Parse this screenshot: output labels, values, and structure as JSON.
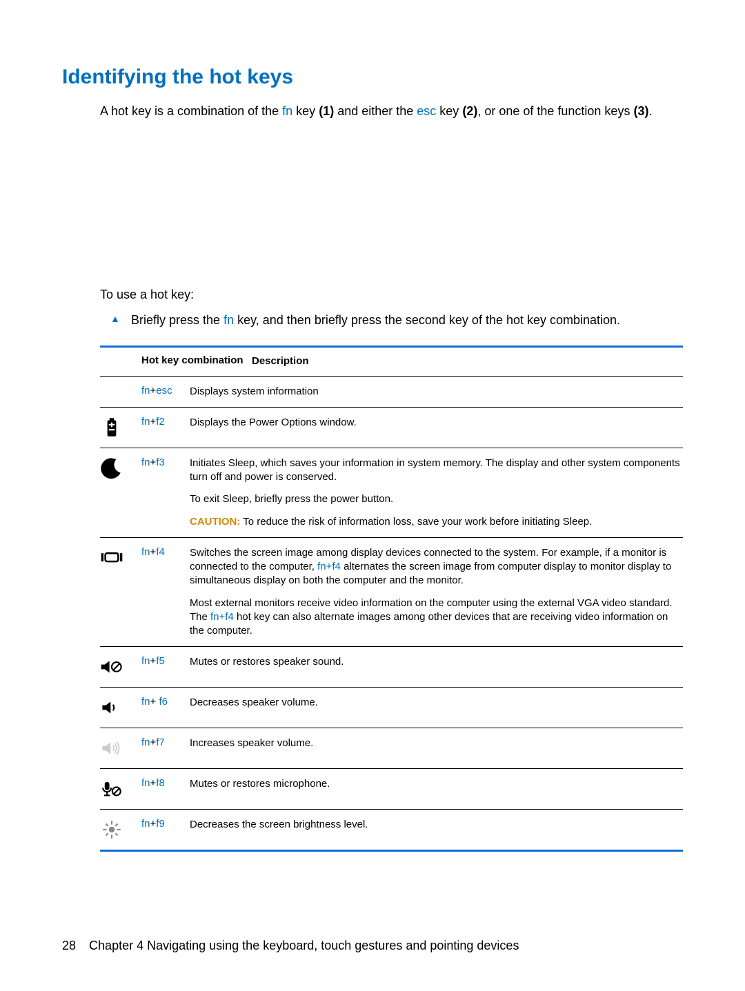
{
  "title": "Identifying the hot keys",
  "intro": {
    "pre": "A hot key is a combination of the ",
    "fn": "fn",
    "mid1": " key ",
    "one": "(1)",
    "mid2": " and either the ",
    "esc": "esc",
    "mid3": " key ",
    "two": "(2)",
    "mid4": ", or one of the function keys ",
    "three": "(3)",
    "end": "."
  },
  "use_line": "To use a hot key:",
  "bullet": {
    "pre": "Briefly press the ",
    "fn": "fn",
    "post": " key, and then briefly press the second key of the hot key combination."
  },
  "hdr": {
    "combo": "Hot key combination",
    "desc": "Description"
  },
  "rows": [
    {
      "icon": "",
      "k1": "fn",
      "op": "+",
      "k2": "esc",
      "desc": "Displays system information"
    },
    {
      "icon": "battery",
      "k1": "fn",
      "op": "+",
      "k2": "f2",
      "desc": "Displays the Power Options window."
    },
    {
      "icon": "moon",
      "k1": "fn",
      "op": "+",
      "k2": "f3",
      "p1": "Initiates Sleep, which saves your information in system memory. The display and other system components turn off and power is conserved.",
      "p2": "To exit Sleep, briefly press the power button.",
      "caution_label": "CAUTION:",
      "caution_text": "  To reduce the risk of information loss, save your work before initiating Sleep."
    },
    {
      "icon": "display",
      "k1": "fn",
      "op": "+",
      "k2": "f4",
      "p1a": "Switches the screen image among display devices connected to the system. For example, if a monitor is connected to the computer, ",
      "p1k": "fn+f4",
      "p1b": " alternates the screen image from computer display to monitor display to simultaneous display on both the computer and the monitor.",
      "p2a": "Most external monitors receive video information on the computer using the external VGA video standard. The ",
      "p2k": "fn+f4",
      "p2b": " hot key can also alternate images among other devices that are receiving video information on the computer."
    },
    {
      "icon": "mute",
      "k1": "fn",
      "op": "+",
      "k2": "f5",
      "desc": "Mutes or restores speaker sound."
    },
    {
      "icon": "voldown",
      "k1": "fn",
      "op": "+ ",
      "k2": "f6",
      "desc": "Decreases speaker volume."
    },
    {
      "icon": "volup",
      "k1": "fn",
      "op": "+",
      "k2": "f7",
      "desc": "Increases speaker volume."
    },
    {
      "icon": "micmute",
      "k1": "fn",
      "op": "+",
      "k2": "f8",
      "desc": "Mutes or restores microphone."
    },
    {
      "icon": "bright",
      "k1": "fn",
      "op": "+",
      "k2": "f9",
      "desc": "Decreases the screen brightness level."
    }
  ],
  "footer": {
    "page": "28",
    "chapter": "Chapter 4   Navigating using the keyboard, touch gestures and pointing devices"
  }
}
